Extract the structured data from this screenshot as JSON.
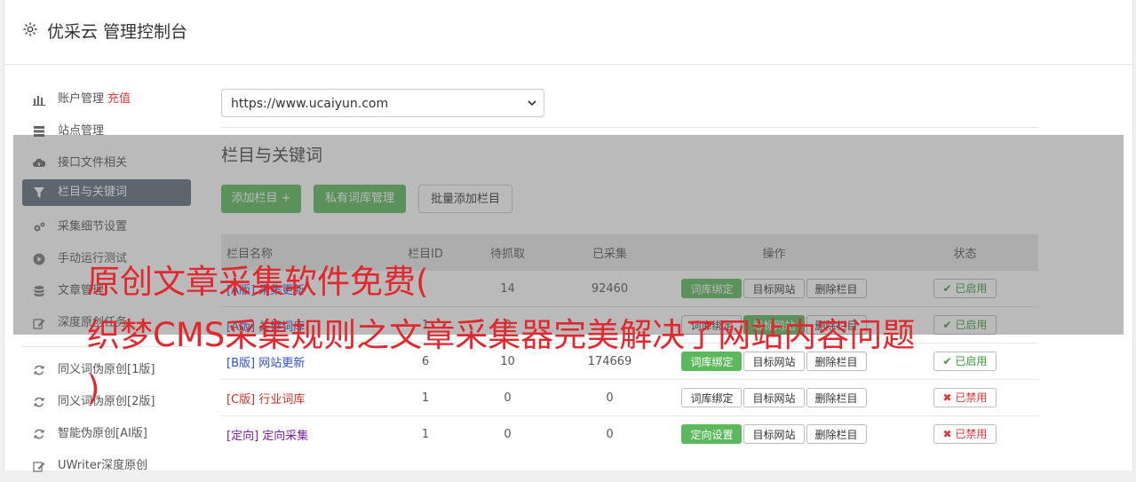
{
  "app": {
    "title": "优采云 管理控制台"
  },
  "sidebar": {
    "items": [
      {
        "label": "账户管理",
        "badge": "充值",
        "icon": "bar-chart-icon"
      },
      {
        "label": "站点管理",
        "icon": "server-icon"
      },
      {
        "label": "接口文件相关",
        "icon": "cloud-upload-icon"
      },
      {
        "label": "栏目与关键词",
        "icon": "filter-icon",
        "active": true
      },
      {
        "label": "采集细节设置",
        "icon": "gears-icon"
      },
      {
        "label": "手动运行测试",
        "icon": "play-circle-icon"
      },
      {
        "label": "文章管理",
        "icon": "database-icon"
      },
      {
        "label": "深度原创任务",
        "icon": "edit-icon"
      }
    ],
    "items2": [
      {
        "label": "同义词伪原创[1版]",
        "icon": "refresh-icon"
      },
      {
        "label": "同义词伪原创[2版]",
        "icon": "refresh-icon"
      },
      {
        "label": "智能伪原创[AI版]",
        "icon": "refresh-icon"
      },
      {
        "label": "UWriter深度原创",
        "icon": "edit-icon"
      }
    ]
  },
  "main": {
    "site_select": "https://www.ucaiyun.com",
    "section_title": "栏目与关键词",
    "buttons": {
      "add": "添加栏目 +",
      "private_lib": "私有词库管理",
      "batch_add": "批量添加栏目"
    },
    "table": {
      "headers": [
        "栏目名称",
        "栏目ID",
        "待抓取",
        "已采集",
        "操作",
        "状态"
      ],
      "rows": [
        {
          "tag": "[A版]",
          "name": "采集更新",
          "id": "",
          "pending": "14",
          "collected": "92460",
          "op1": "词库绑定",
          "op2": "目标网站",
          "op3": "删除栏目",
          "status": "已启用"
        },
        {
          "tag": "[A版]",
          "name": "关键词库",
          "id": "1",
          "pending": "0",
          "collected": "",
          "op1": "词库绑定",
          "op2": "目标网站",
          "op3": "删除栏目",
          "status": "已启用"
        },
        {
          "tag": "[B版]",
          "name": "网站更新",
          "id": "6",
          "pending": "10",
          "collected": "174669",
          "op1": "词库绑定",
          "op2": "目标网站",
          "op3": "删除栏目",
          "status": "已启用"
        },
        {
          "tag": "[C版]",
          "name": "行业词库",
          "id": "1",
          "pending": "0",
          "collected": "0",
          "op1": "词库绑定",
          "op2": "目标网站",
          "op3": "删除栏目",
          "status": "已禁用"
        },
        {
          "tag": "[定向]",
          "name": "定向采集",
          "id": "1",
          "pending": "0",
          "collected": "0",
          "op1": "定向设置",
          "op2": "目标网站",
          "op3": "删除栏目",
          "status": "已禁用"
        }
      ]
    }
  },
  "watermark": {
    "line1": "原创文章采集软件免费(",
    "line2": "织梦CMS采集规则之文章采集器完美解决了网站内容问题",
    "line3": ")"
  },
  "colors": {
    "accent_green": "#5cb85c",
    "active_nav": "#5f6e7c",
    "watermark_red": "#e0282e"
  }
}
